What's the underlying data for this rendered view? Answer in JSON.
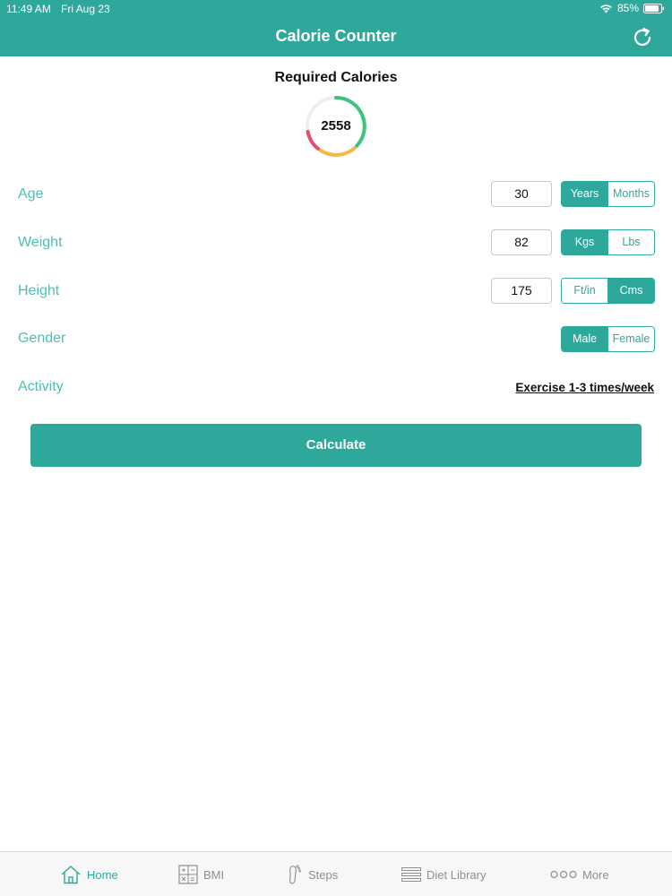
{
  "status": {
    "time": "11:49 AM",
    "date": "Fri Aug 23",
    "battery": "85%"
  },
  "nav": {
    "title": "Calorie Counter"
  },
  "calories": {
    "heading": "Required Calories",
    "value": "2558"
  },
  "fields": {
    "age": {
      "label": "Age",
      "value": "30",
      "options": [
        "Years",
        "Months"
      ],
      "selected": "Years"
    },
    "weight": {
      "label": "Weight",
      "value": "82",
      "options": [
        "Kgs",
        "Lbs"
      ],
      "selected": "Kgs"
    },
    "height": {
      "label": "Height",
      "value": "175",
      "options": [
        "Ft/in",
        "Cms"
      ],
      "selected": "Cms"
    },
    "gender": {
      "label": "Gender",
      "options": [
        "Male",
        "Female"
      ],
      "selected": "Male"
    },
    "activity": {
      "label": "Activity",
      "value": "Exercise 1-3 times/week"
    }
  },
  "calculate_label": "Calculate",
  "tabs": [
    {
      "label": "Home",
      "icon": "home-icon",
      "active": true
    },
    {
      "label": "BMI",
      "icon": "calculator-icon",
      "active": false
    },
    {
      "label": "Steps",
      "icon": "footprint-icon",
      "active": false
    },
    {
      "label": "Diet Library",
      "icon": "list-icon",
      "active": false
    },
    {
      "label": "More",
      "icon": "more-icon",
      "active": false
    }
  ],
  "colors": {
    "accent": "#2fa89c",
    "label": "#4dbfb2",
    "ring_green": "#3cc47c",
    "ring_orange": "#f5b942",
    "ring_red": "#e2506b"
  }
}
